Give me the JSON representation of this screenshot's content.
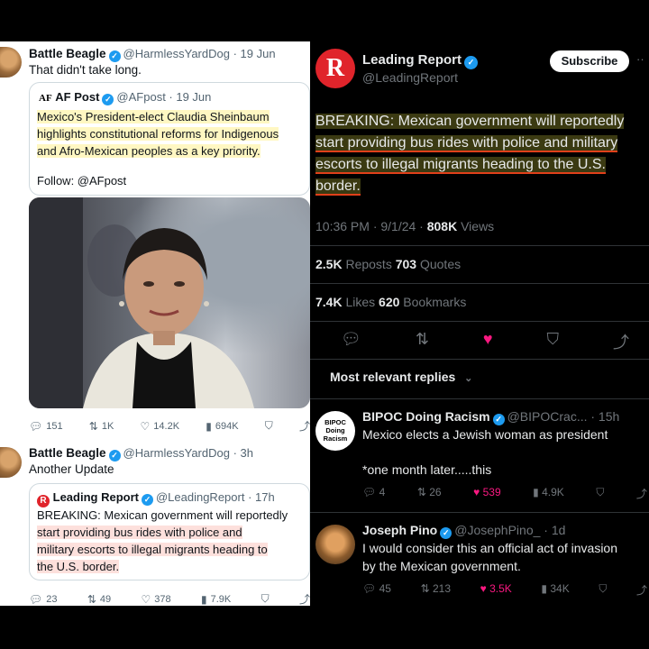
{
  "left": {
    "tweet1": {
      "name": "Battle Beagle",
      "handle_time": "@HarmlessYardDog · 19 Jun",
      "text": "That didn't take long.",
      "quote": {
        "logo": "AF",
        "name": "AF Post",
        "handle_time": "@AFpost · 19 Jun",
        "lines": [
          "Mexico's President-elect Claudia Sheinbaum",
          "highlights constitutional reforms for Indigenous",
          "and Afro-Mexican peoples as a key priority."
        ],
        "follow": "Follow: @AFpost"
      },
      "stats": {
        "replies": "151",
        "reposts": "1K",
        "likes": "14.2K",
        "views": "694K"
      }
    },
    "tweet2": {
      "name": "Battle Beagle",
      "handle_time": "@HarmlessYardDog · 3h",
      "text": "Another Update",
      "quote": {
        "name": "Leading Report",
        "handle_time": "@LeadingReport · 17h",
        "lines": [
          "BREAKING: Mexican government will reportedly",
          "start providing bus rides with police and",
          "military escorts to illegal migrants heading to",
          "the U.S. border."
        ]
      },
      "stats": {
        "replies": "23",
        "reposts": "49",
        "likes": "378",
        "views": "7.9K"
      }
    }
  },
  "right": {
    "header": {
      "name": "Leading Report",
      "handle": "@LeadingReport",
      "subscribe": "Subscribe",
      "more": "··"
    },
    "post": {
      "lines": [
        "BREAKING: Mexican government will reportedly",
        "start providing bus rides with police and military",
        "escorts to illegal migrants heading to the U.S.",
        "border."
      ],
      "time": "10:36 PM · 9/1/24 · ",
      "views_num": "808K",
      "views_label": " Views",
      "reposts_num": "2.5K",
      "reposts_label": " Reposts ",
      "quotes_num": "703",
      "quotes_label": " Quotes",
      "likes_num": "7.4K",
      "likes_label": " Likes ",
      "bookmarks_num": "620",
      "bookmarks_label": " Bookmarks"
    },
    "replies_sort": "Most relevant replies",
    "replies": [
      {
        "avatar_text": "BIPOC Doing Racism",
        "name": "BIPOC Doing Racism",
        "handle_time": "@BIPOCrac... · 15h",
        "line1": "Mexico elects a Jewish woman as president",
        "line2": "*one month later.....this",
        "stats": {
          "replies": "4",
          "reposts": "26",
          "likes": "539",
          "views": "4.9K"
        }
      },
      {
        "name": "Joseph Pino",
        "handle_time": "@JosephPino_ · 1d",
        "line1": "I would consider this an official act of invasion",
        "line2": "by the Mexican government.",
        "stats": {
          "replies": "45",
          "reposts": "213",
          "likes": "3.5K",
          "views": "34K"
        }
      }
    ]
  },
  "colors": {
    "like_pink": "#f91880",
    "verified_blue": "#1d9bf0",
    "leading_report_red": "#e0242b",
    "highlight_underline": "#e0401a"
  }
}
